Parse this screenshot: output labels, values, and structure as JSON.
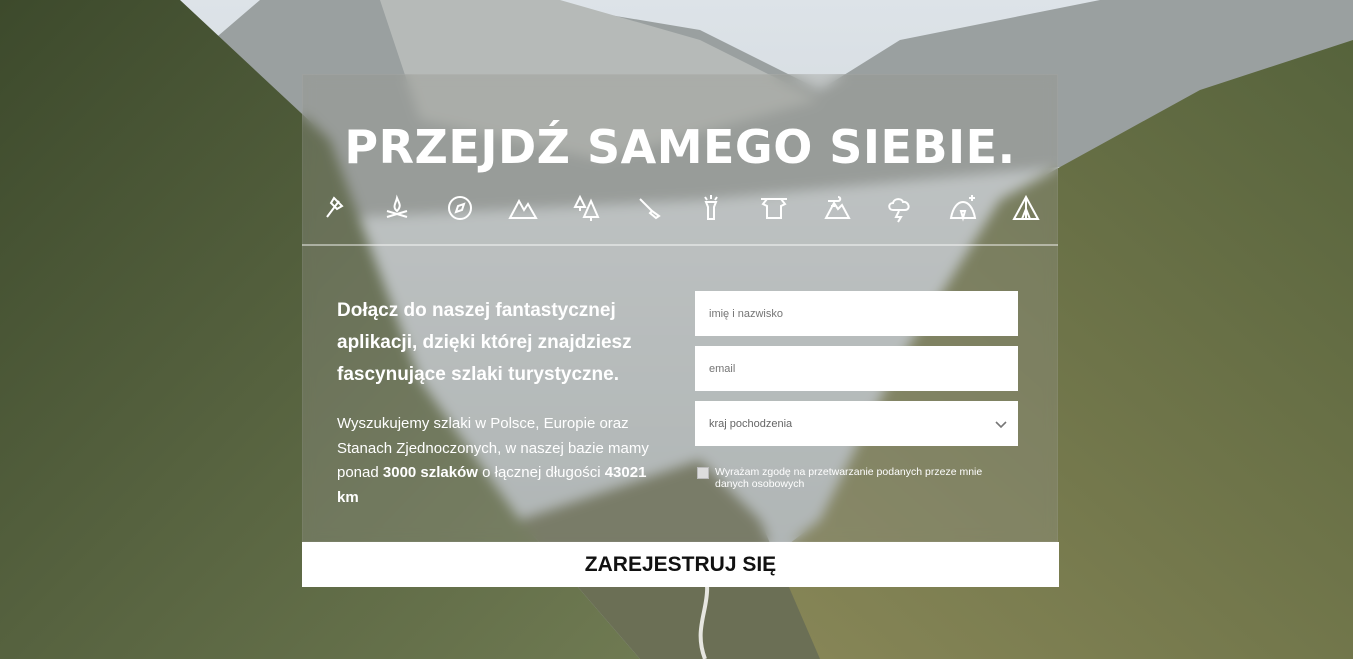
{
  "hero": {
    "title": "PRZEJDŹ SAMEGO SIEBIE."
  },
  "icons": [
    "axe-icon",
    "campfire-icon",
    "compass-icon",
    "mountains-icon",
    "trees-icon",
    "knife-icon",
    "flashlight-icon",
    "clothesline-icon",
    "wind-icon",
    "storm-cloud-icon",
    "tent-night-icon",
    "tent-icon"
  ],
  "intro": {
    "lead": "Dołącz do naszej fantastycznej aplikacji, dzięki której znajdziesz fascynujące szlaki turystyczne.",
    "desc_part1": "Wyszukujemy szlaki w Polsce, Europie oraz Stanach Zjednoczonych, w naszej bazie mamy ponad ",
    "desc_bold1": "3000 szlaków",
    "desc_part2": " o łącznej długości ",
    "desc_bold2": "43021 km"
  },
  "form": {
    "name_placeholder": "imię i nazwisko",
    "email_placeholder": "email",
    "country_selected": "kraj pochodzenia",
    "consent": "Wyrażam zgodę na przetwarzanie podanych przeze mnie danych osobowych",
    "submit": "ZAREJESTRUJ SIĘ"
  },
  "colors": {
    "overlay": "#9a9a8c",
    "text": "#ffffff",
    "button_bg": "#ffffff"
  }
}
